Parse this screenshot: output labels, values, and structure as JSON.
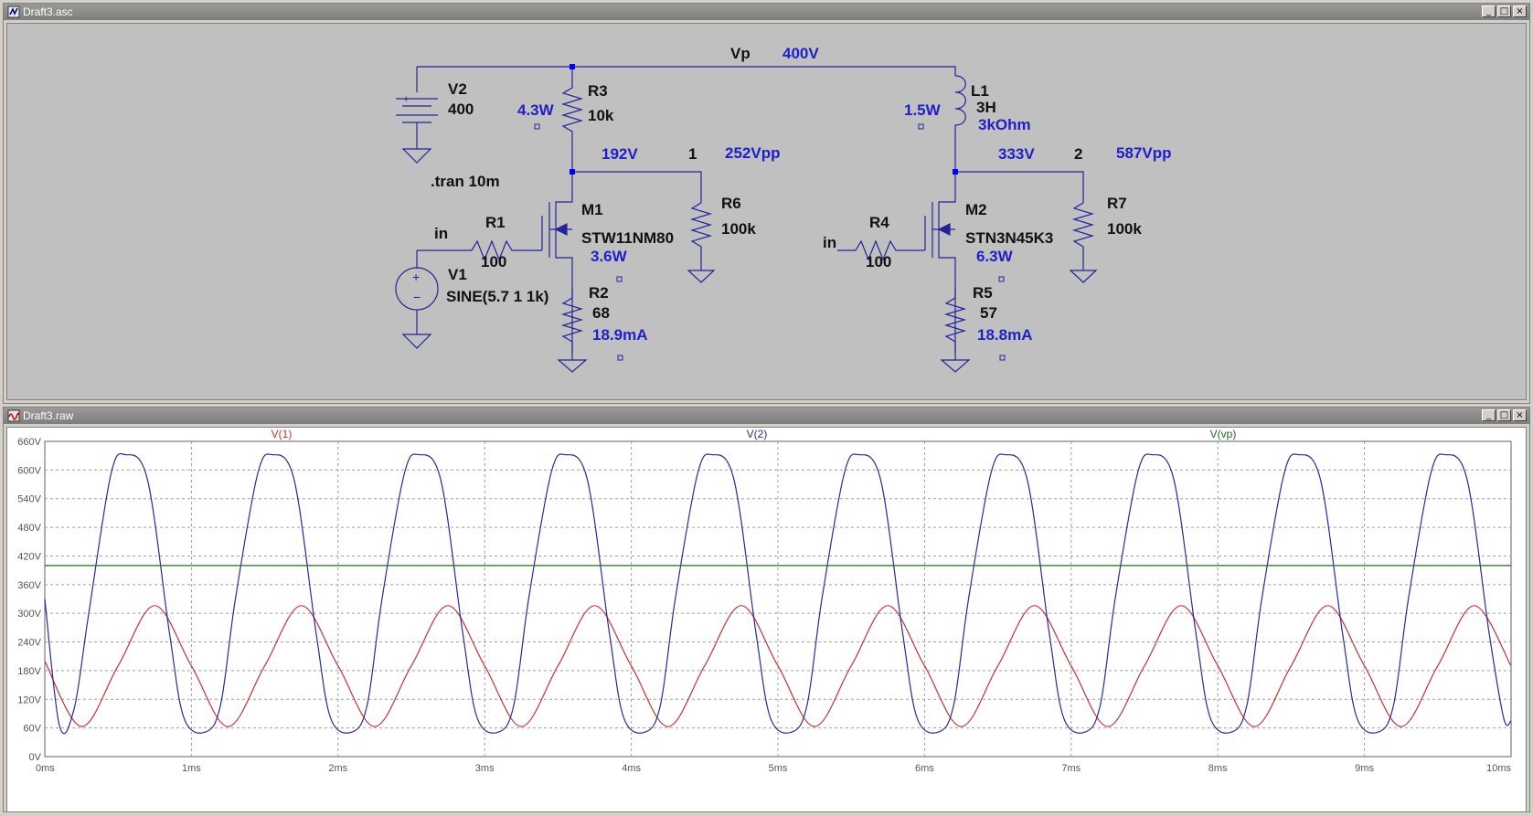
{
  "schematic_window": {
    "title": "Draft3.asc",
    "nodes": {
      "vp_name": "Vp",
      "vp_value": "400V",
      "n1_voltage": "192V",
      "n1_name": "1",
      "n1_vpp": "252Vpp",
      "n2_voltage": "333V",
      "n2_name": "2",
      "n2_vpp": "587Vpp",
      "in_left": "in",
      "in_right": "in"
    },
    "components": {
      "v2_name": "V2",
      "v2_value": "400",
      "r3_name": "R3",
      "r3_value": "10k",
      "r3_power": "4.3W",
      "l1_name": "L1",
      "l1_value": "3H",
      "l1_resistance": "3kOhm",
      "l1_power": "1.5W",
      "tran": ".tran 10m",
      "m1_name": "M1",
      "m1_model": "STW11NM80",
      "m1_power": "3.6W",
      "r6_name": "R6",
      "r6_value": "100k",
      "r1_name": "R1",
      "r1_value": "100",
      "v1_name": "V1",
      "v1_value": "SINE(5.7 1 1k)",
      "r2_name": "R2",
      "r2_value": "68",
      "r2_current": "18.9mA",
      "m2_name": "M2",
      "m2_model": "STN3N45K3",
      "m2_power": "6.3W",
      "r7_name": "R7",
      "r7_value": "100k",
      "r4_name": "R4",
      "r4_value": "100",
      "r5_name": "R5",
      "r5_value": "57",
      "r5_current": "18.8mA"
    }
  },
  "plot_window": {
    "title": "Draft3.raw"
  },
  "chart_data": {
    "type": "line",
    "x_unit": "ms",
    "xlim": [
      0,
      10
    ],
    "ylim": [
      0,
      660
    ],
    "x_ticks": [
      "0ms",
      "1ms",
      "2ms",
      "3ms",
      "4ms",
      "5ms",
      "6ms",
      "7ms",
      "8ms",
      "9ms",
      "10ms"
    ],
    "y_ticks": [
      "0V",
      "60V",
      "120V",
      "180V",
      "240V",
      "300V",
      "360V",
      "420V",
      "480V",
      "540V",
      "600V",
      "660V"
    ],
    "grid": true,
    "series": [
      {
        "name": "V(1)",
        "color": "#c83232",
        "x": [
          0,
          0.25,
          0.5,
          0.75,
          1,
          1.25,
          1.5,
          1.75,
          2,
          2.25,
          2.5,
          2.75,
          3,
          3.25,
          3.5,
          3.75,
          4,
          4.25,
          4.5,
          4.75,
          5,
          5.25,
          5.5,
          5.75,
          6,
          6.25,
          6.5,
          6.75,
          7,
          7.25,
          7.5,
          7.75,
          8,
          8.25,
          8.5,
          8.75,
          9,
          9.25,
          9.5,
          9.75,
          10
        ],
        "y": [
          200,
          63,
          190,
          316,
          190,
          63,
          190,
          316,
          190,
          63,
          190,
          316,
          190,
          63,
          190,
          316,
          190,
          63,
          190,
          316,
          190,
          63,
          190,
          316,
          190,
          63,
          190,
          316,
          190,
          63,
          190,
          316,
          190,
          63,
          190,
          316,
          190,
          63,
          190,
          316,
          190
        ]
      },
      {
        "name": "V(2)",
        "color": "#2a2a9a",
        "x": [
          0,
          0.1,
          0.2,
          0.3,
          0.45,
          0.55,
          0.7,
          0.85,
          0.95,
          1.1,
          1.2,
          1.3,
          1.45,
          1.55,
          1.7,
          1.85,
          1.95,
          2.1,
          2.2,
          2.3,
          2.45,
          2.55,
          2.7,
          2.85,
          2.95,
          3.1,
          3.2,
          3.3,
          3.45,
          3.55,
          3.7,
          3.85,
          3.95,
          4.1,
          4.2,
          4.3,
          4.45,
          4.55,
          4.7,
          4.85,
          4.95,
          5.1,
          5.2,
          5.3,
          5.45,
          5.55,
          5.7,
          5.85,
          5.95,
          6.1,
          6.2,
          6.3,
          6.45,
          6.55,
          6.7,
          6.85,
          6.95,
          7.1,
          7.2,
          7.3,
          7.45,
          7.55,
          7.7,
          7.85,
          7.95,
          8.1,
          8.2,
          8.3,
          8.45,
          8.55,
          8.7,
          8.85,
          8.95,
          9.1,
          9.2,
          9.3,
          9.45,
          9.55,
          9.7,
          9.85,
          9.95,
          10
        ],
        "y": [
          330,
          65,
          100,
          300,
          590,
          632,
          580,
          260,
          80,
          52,
          110,
          330,
          590,
          632,
          580,
          260,
          80,
          52,
          110,
          330,
          590,
          632,
          580,
          260,
          80,
          52,
          110,
          330,
          590,
          632,
          580,
          260,
          80,
          52,
          110,
          330,
          590,
          632,
          580,
          260,
          80,
          52,
          110,
          330,
          590,
          632,
          580,
          260,
          80,
          52,
          110,
          330,
          590,
          632,
          580,
          260,
          80,
          52,
          110,
          330,
          590,
          632,
          580,
          260,
          80,
          52,
          110,
          330,
          590,
          632,
          580,
          260,
          80,
          52,
          110,
          330,
          590,
          632,
          580,
          260,
          80,
          75
        ]
      },
      {
        "name": "V(vp)",
        "color": "#1e6e1e",
        "x": [
          0,
          10
        ],
        "y": [
          400,
          400
        ]
      }
    ]
  }
}
